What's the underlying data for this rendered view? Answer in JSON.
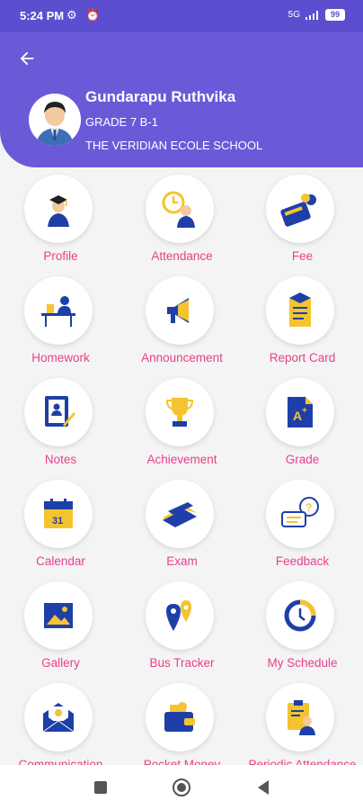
{
  "status": {
    "time": "5:24 PM",
    "left_icons": "⚙ ⏰",
    "signal": "5G",
    "battery": "99"
  },
  "header": {
    "back_icon": "arrow-left-icon",
    "name": "Gundarapu Ruthvika",
    "grade": "GRADE 7 B-1",
    "school": "THE VERIDIAN ECOLE SCHOOL"
  },
  "colors": {
    "primary": "#6a5ad8",
    "label": "#e8408a",
    "icon_blue": "#1f3fa8",
    "icon_yellow": "#f4c430"
  },
  "tiles": [
    {
      "label": "Profile",
      "icon": "graduate-icon"
    },
    {
      "label": "Attendance",
      "icon": "clock-person-icon"
    },
    {
      "label": "Fee",
      "icon": "calculator-money-icon"
    },
    {
      "label": "Homework",
      "icon": "desk-student-icon"
    },
    {
      "label": "Announcement",
      "icon": "megaphone-icon"
    },
    {
      "label": "Report Card",
      "icon": "report-card-icon"
    },
    {
      "label": "Notes",
      "icon": "notes-pen-icon"
    },
    {
      "label": "Achievement",
      "icon": "trophy-icon"
    },
    {
      "label": "Grade",
      "icon": "grade-a-plus-icon"
    },
    {
      "label": "Calendar",
      "icon": "calendar-icon"
    },
    {
      "label": "Exam",
      "icon": "exam-book-icon"
    },
    {
      "label": "Feedback",
      "icon": "chat-bubbles-icon"
    },
    {
      "label": "Gallery",
      "icon": "image-icon"
    },
    {
      "label": "Bus Tracker",
      "icon": "map-pin-icon"
    },
    {
      "label": "My Schedule",
      "icon": "schedule-clock-icon"
    },
    {
      "label": "Communication",
      "icon": "envelope-icon"
    },
    {
      "label": "Pocket Money",
      "icon": "wallet-icon"
    },
    {
      "label": "Periodic Attendance",
      "icon": "clipboard-person-icon"
    }
  ],
  "nav": {
    "recent": "recent-apps-icon",
    "home": "home-icon",
    "back": "back-triangle-icon"
  }
}
